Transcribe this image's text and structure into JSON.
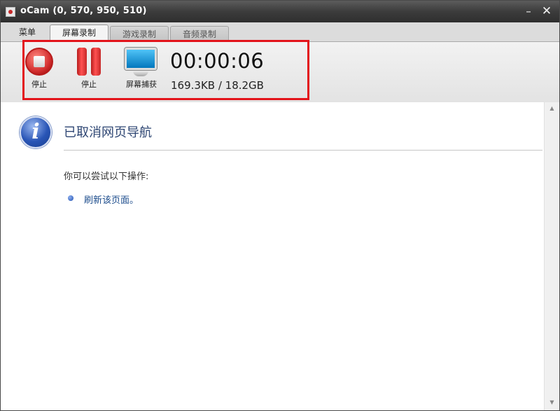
{
  "window": {
    "title": "oCam (0, 570, 950, 510)",
    "minimize_glyph": "–",
    "close_glyph": "✕"
  },
  "tabs": [
    {
      "label": "菜单",
      "state": "plain"
    },
    {
      "label": "屏幕录制",
      "state": "active"
    },
    {
      "label": "游戏录制",
      "state": "inactive"
    },
    {
      "label": "音频录制",
      "state": "inactive"
    }
  ],
  "toolbar": {
    "stop_label": "停止",
    "pause_label": "停止",
    "capture_label": "屏幕捕获",
    "timer": "00:00:06",
    "size": "169.3KB / 18.2GB",
    "icons": {
      "stop": "stop-record-icon",
      "pause": "pause-icon",
      "capture": "monitor-icon"
    },
    "highlight_color": "#e3141b"
  },
  "content": {
    "heading": "已取消网页导航",
    "subheading": "你可以尝试以下操作:",
    "link_text": "刷新该页面。",
    "icon": "info-icon",
    "icon_glyph": "i"
  },
  "scrollbar": {
    "up_glyph": "▲",
    "down_glyph": "▼"
  },
  "colors": {
    "titlebar": "#3c3c3c",
    "heading": "#2e4673",
    "link": "#1c4c8c"
  }
}
